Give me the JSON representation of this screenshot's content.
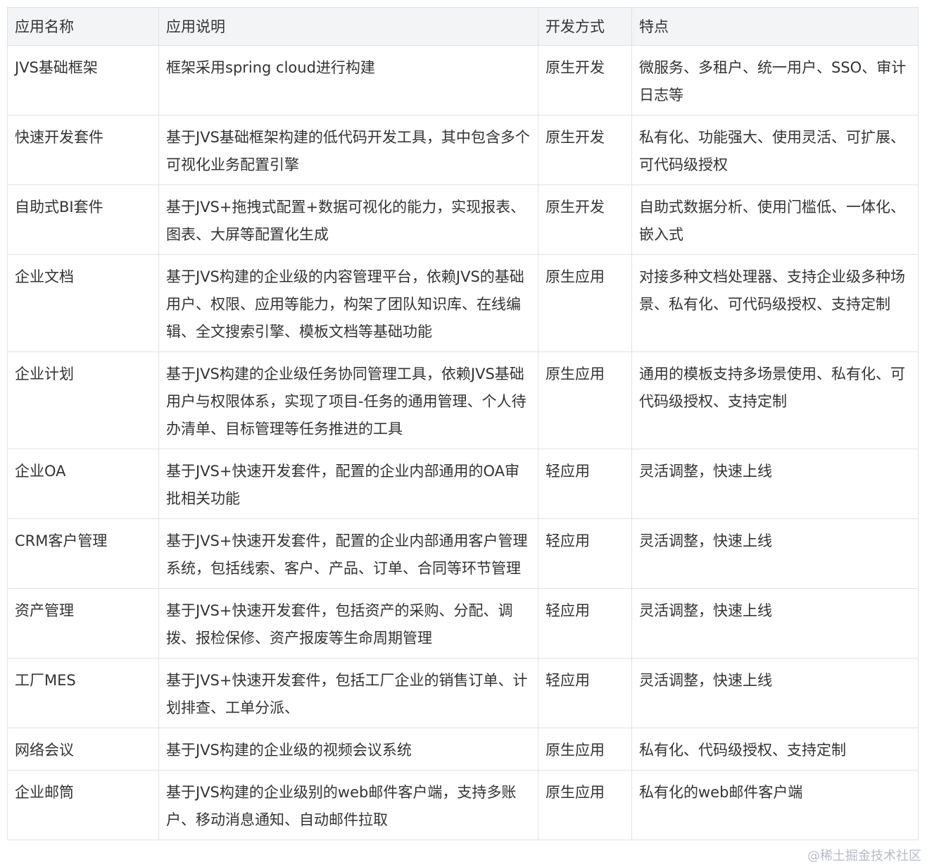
{
  "table": {
    "headers": [
      "应用名称",
      "应用说明",
      "开发方式",
      "特点"
    ],
    "rows": [
      [
        "JVS基础框架",
        "框架采用spring cloud进行构建",
        "原生开发",
        "微服务、多租户、统一用户、SSO、审计日志等"
      ],
      [
        "快速开发套件",
        "基于JVS基础框架构建的低代码开发工具，其中包含多个可视化业务配置引擎",
        "原生开发",
        "私有化、功能强大、使用灵活、可扩展、可代码级授权"
      ],
      [
        "自助式BI套件",
        "基于JVS+拖拽式配置+数据可视化的能力，实现报表、图表、大屏等配置化生成",
        "原生开发",
        "自助式数据分析、使用门槛低、一体化、嵌入式"
      ],
      [
        "企业文档",
        "基于JVS构建的企业级的内容管理平台，依赖JVS的基础用户、权限、应用等能力，构架了团队知识库、在线编辑、全文搜索引擎、模板文档等基础功能",
        "原生应用",
        "对接多种文档处理器、支持企业级多种场景、私有化、可代码级授权、支持定制"
      ],
      [
        "企业计划",
        "基于JVS构建的企业级任务协同管理工具，依赖JVS基础用户与权限体系，实现了项目-任务的通用管理、个人待办清单、目标管理等任务推进的工具",
        "原生应用",
        "通用的模板支持多场景使用、私有化、可代码级授权、支持定制"
      ],
      [
        "企业OA",
        "基于JVS+快速开发套件，配置的企业内部通用的OA审批相关功能",
        "轻应用",
        "灵活调整，快速上线"
      ],
      [
        "CRM客户管理",
        "基于JVS+快速开发套件，配置的企业内部通用客户管理系统，包括线索、客户、产品、订单、合同等环节管理",
        "轻应用",
        "灵活调整，快速上线"
      ],
      [
        "资产管理",
        "基于JVS+快速开发套件，包括资产的采购、分配、调拨、报检保修、资产报废等生命周期管理",
        "轻应用",
        "灵活调整，快速上线"
      ],
      [
        "工厂MES",
        "基于JVS+快速开发套件，包括工厂企业的销售订单、计划排查、工单分派、",
        "轻应用",
        "灵活调整，快速上线"
      ],
      [
        "网络会议",
        "基于JVS构建的企业级的视频会议系统",
        "原生应用",
        "私有化、代码级授权、支持定制"
      ],
      [
        "企业邮筒",
        "基于JVS构建的企业级别的web邮件客户端，支持多账户、移动消息通知、自动邮件拉取",
        "原生应用",
        "私有化的web邮件客户端"
      ]
    ]
  },
  "watermark": "@稀土掘金技术社区"
}
